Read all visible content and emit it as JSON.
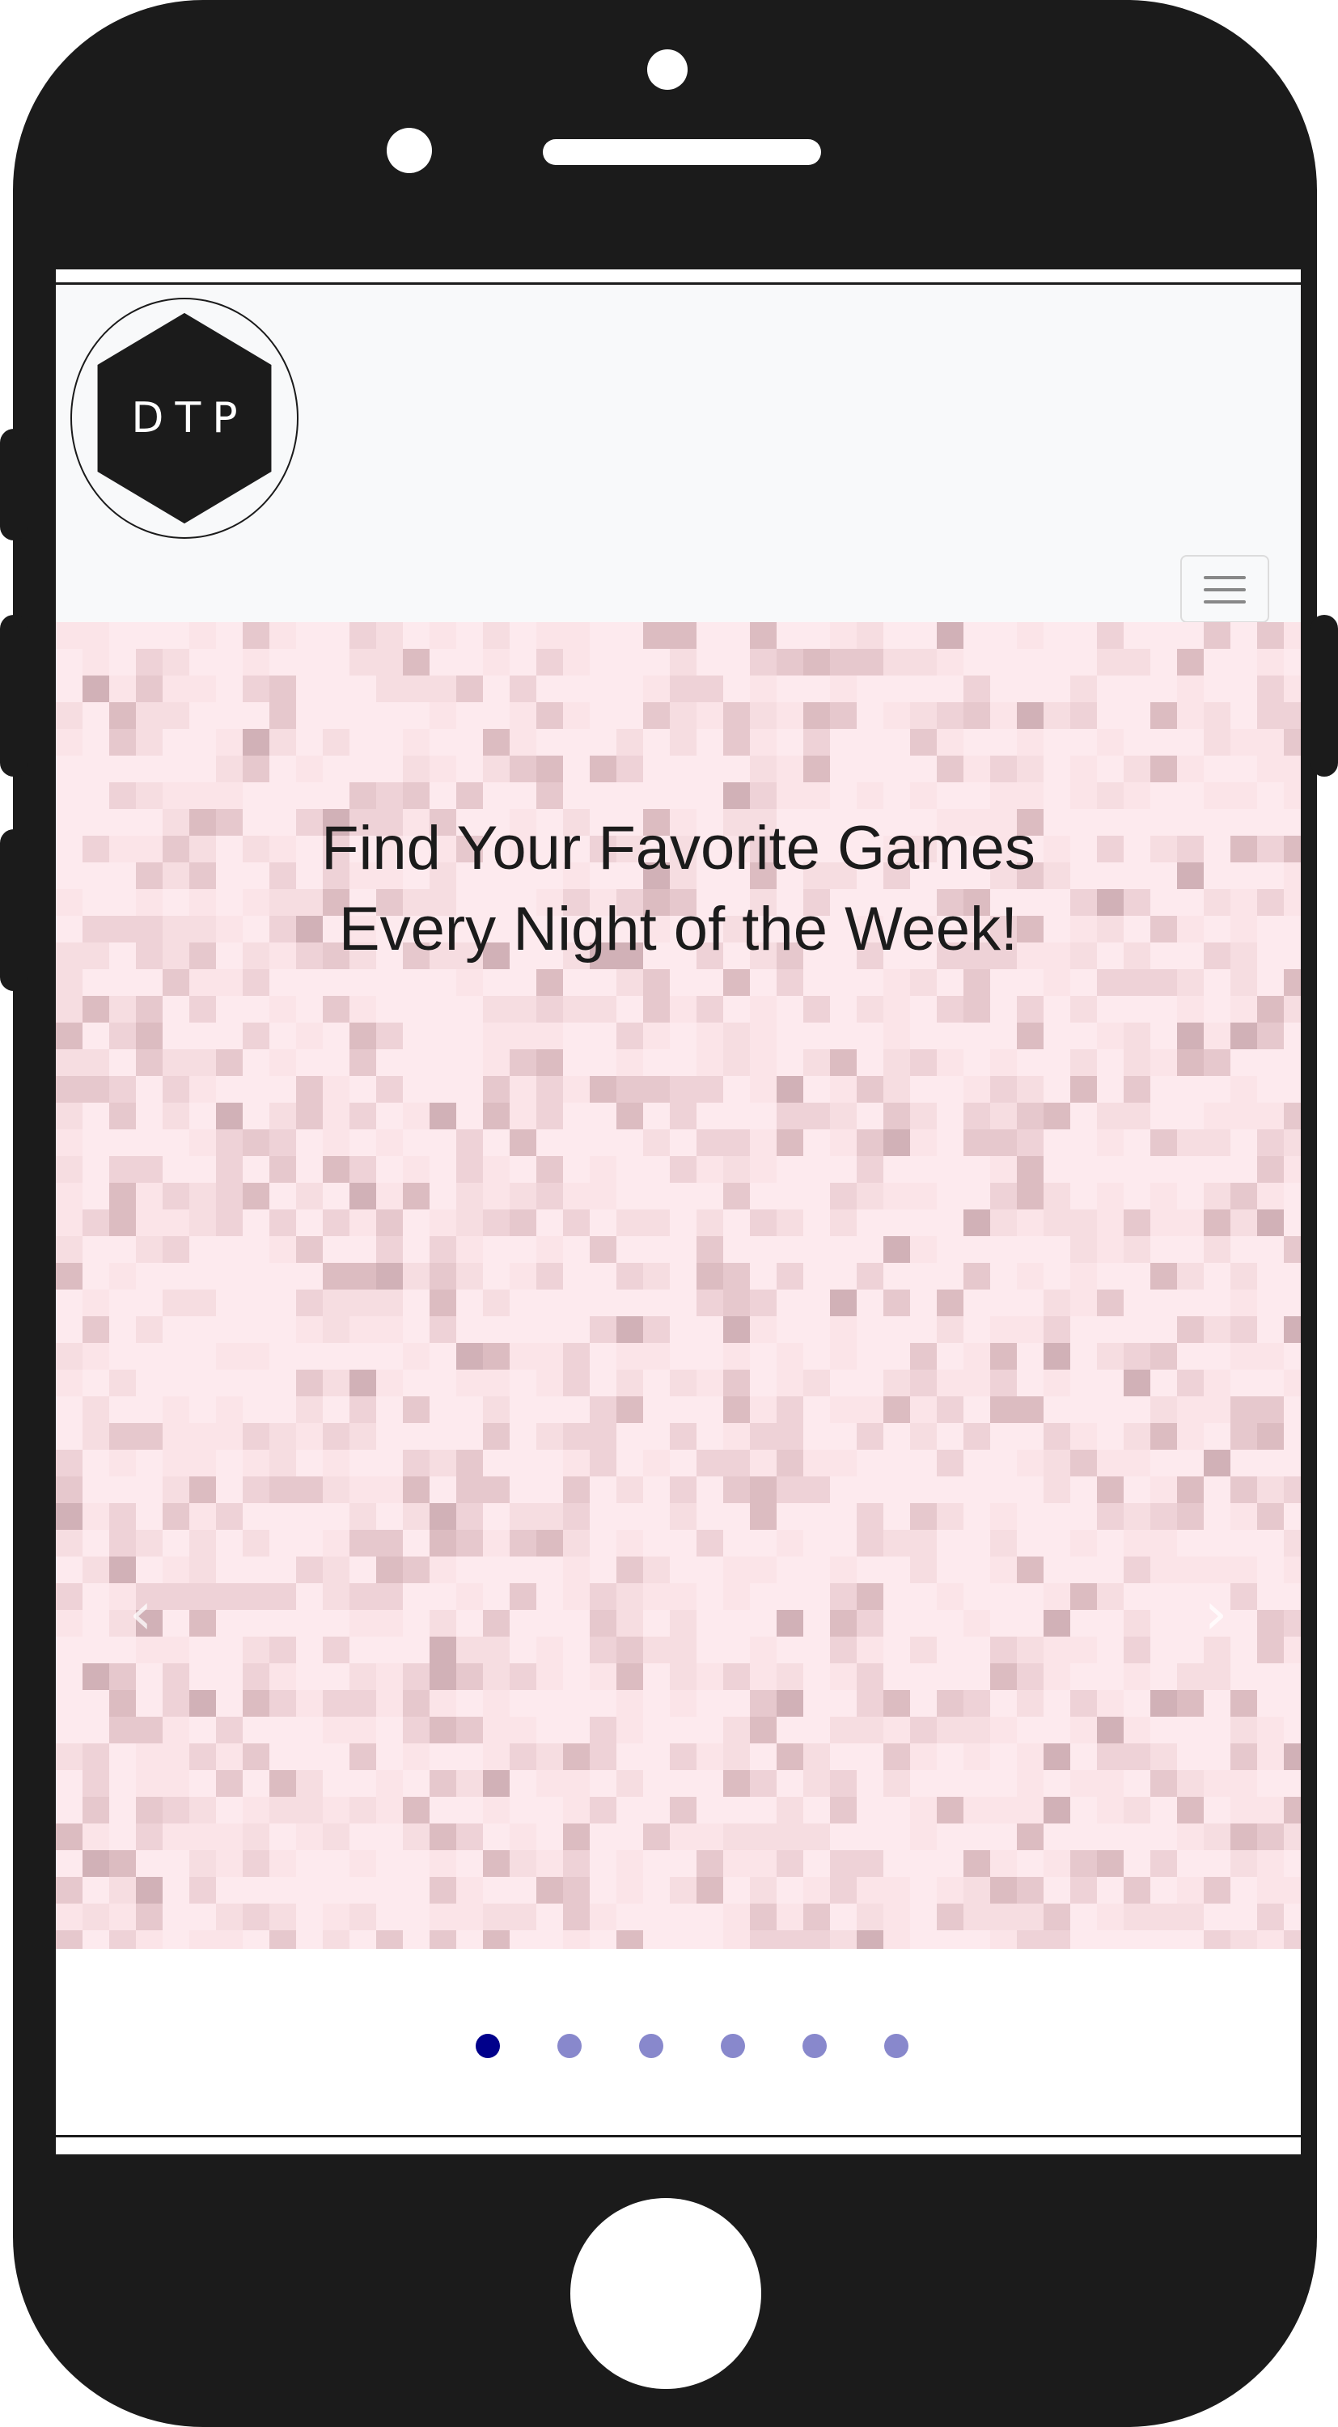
{
  "navbar": {
    "logo_text": "DTP",
    "menu_icon": "hamburger-icon"
  },
  "hero": {
    "title_line1": "Find Your Favorite Games",
    "title_line2": "Every Night of the Week!",
    "prev_icon": "chevron-left-icon",
    "next_icon": "chevron-right-icon"
  },
  "carousel": {
    "slide_count": 6,
    "active_index": 0
  },
  "colors": {
    "phone_body": "#1b1b1b",
    "navbar_bg": "#f8f9fa",
    "hero_bg": "#fdeaee",
    "indicator_active": "#00008b",
    "indicator_inactive": "#8888cc"
  }
}
